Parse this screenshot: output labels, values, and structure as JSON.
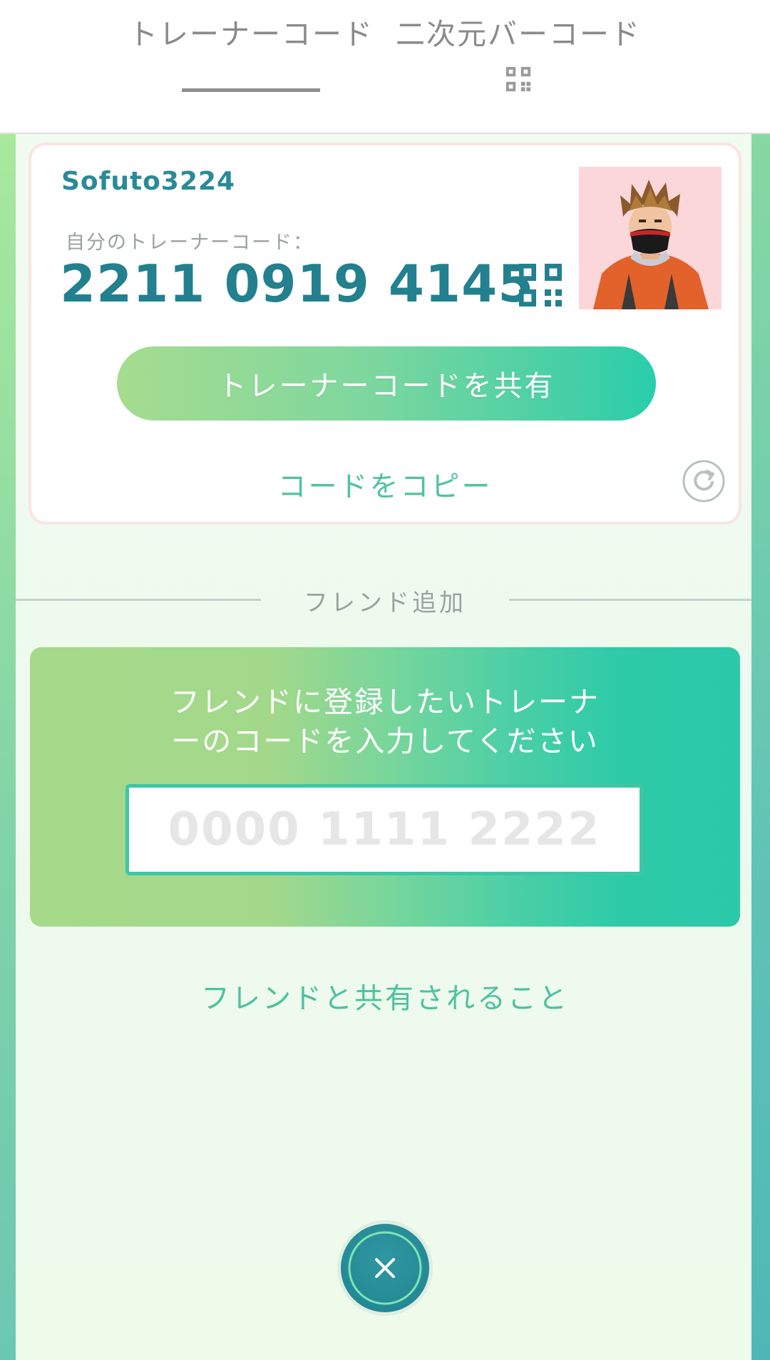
{
  "tabs": {
    "trainer_code": "トレーナーコード",
    "qr_code": "二次元バーコード"
  },
  "card": {
    "trainer_name": "Sofuto3224",
    "code_caption": "自分のトレーナーコード：",
    "trainer_code": "2211 0919 4145",
    "share_button": "トレーナーコードを共有",
    "copy_link": "コードをコピー"
  },
  "friend_add": {
    "divider_label": "フレンド追加",
    "instruction_line1": "フレンドに登録したいトレーナ",
    "instruction_line2": "ーのコードを入力してください",
    "input_placeholder": "0000 1111 2222",
    "input_value": "",
    "shared_link": "フレンドと共有されること"
  },
  "icons": {
    "qr": "qr-code-icon",
    "refresh": "refresh-icon",
    "close": "close-icon"
  },
  "colors": {
    "accent_teal": "#23808e",
    "accent_green": "#4fc3a0",
    "close_button": "#1f8390"
  }
}
